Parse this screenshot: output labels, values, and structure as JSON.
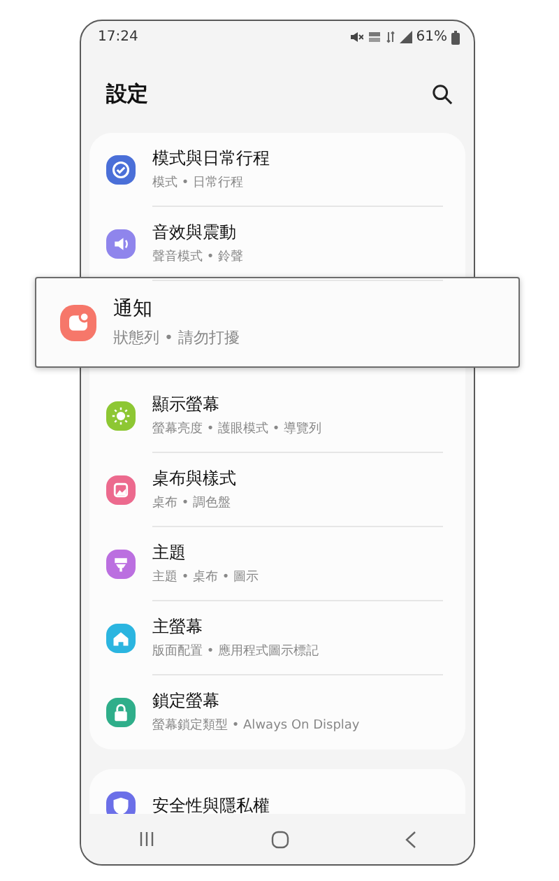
{
  "status_bar": {
    "time": "17:24",
    "battery": "61%"
  },
  "header": {
    "title": "設定"
  },
  "groups": [
    {
      "items": [
        {
          "kind": "modes",
          "color": "#4a6fd8",
          "title": "模式與日常行程",
          "subtitle": "模式 • 日常行程",
          "highlighted": false
        },
        {
          "kind": "sound",
          "color": "#8f85ec",
          "title": "音效與震動",
          "subtitle": "聲音模式 • 鈴聲",
          "highlighted": false
        },
        {
          "kind": "notifications",
          "color": "#f6776a",
          "title": "通知",
          "subtitle": "狀態列 • 請勿打擾",
          "highlighted": true
        },
        {
          "kind": "display",
          "color": "#8dc733",
          "title": "顯示螢幕",
          "subtitle": "螢幕亮度 • 護眼模式 • 導覽列",
          "highlighted": false
        },
        {
          "kind": "wallpaper",
          "color": "#ec6a8e",
          "title": "桌布與樣式",
          "subtitle": "桌布 • 調色盤",
          "highlighted": false
        },
        {
          "kind": "themes",
          "color": "#bb6fe0",
          "title": "主題",
          "subtitle": "主題 • 桌布 • 圖示",
          "highlighted": false
        },
        {
          "kind": "home",
          "color": "#2bb5e0",
          "title": "主螢幕",
          "subtitle": "版面配置 • 應用程式圖示標記",
          "highlighted": false
        },
        {
          "kind": "lock",
          "color": "#2fae8a",
          "title": "鎖定螢幕",
          "subtitle": "螢幕鎖定類型 • Always On Display",
          "highlighted": false
        }
      ]
    },
    {
      "items": [
        {
          "kind": "security",
          "color": "#6b6fe8",
          "title": "安全性與隱私權",
          "highlighted": false
        }
      ]
    }
  ]
}
